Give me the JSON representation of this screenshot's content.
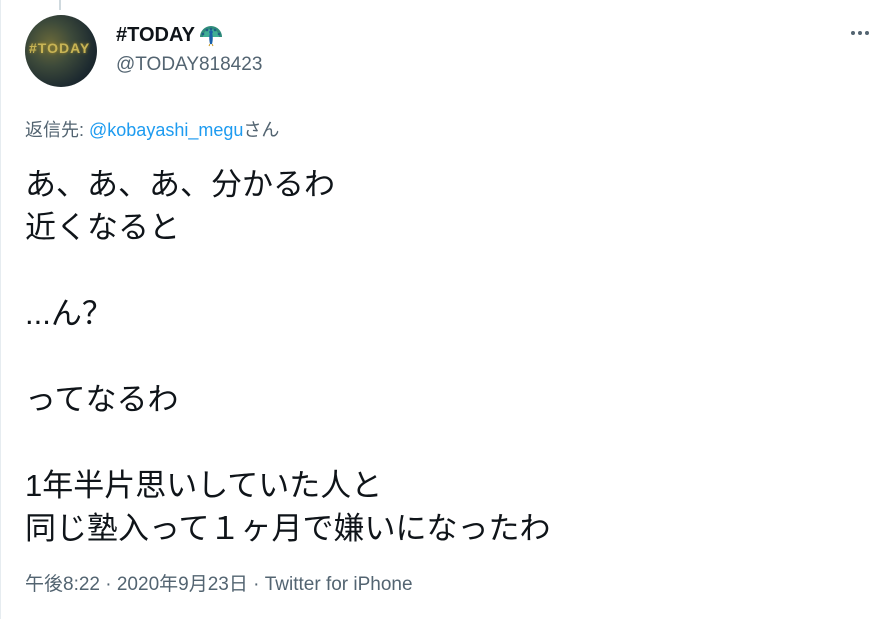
{
  "tweet": {
    "author": {
      "display_name": "#TODAY",
      "handle": "@TODAY818423",
      "avatar_text": "#TODAY",
      "name_icon": "peacock-emoji-icon"
    },
    "more_icon": "more-dots-icon",
    "reply_to": {
      "prefix": "返信先: ",
      "mention": "@kobayashi_megu",
      "suffix": "さん"
    },
    "text_lines": [
      "あ、あ、あ、分かるわ",
      "近くなると",
      "",
      "...ん？",
      "",
      "ってなるわ",
      "",
      "1年半片思いしていた人と",
      "同じ塾入って１ヶ月で嫌いになったわ"
    ],
    "timestamp": "午後8:22 · 2020年9月23日 · ",
    "source": "Twitter for iPhone"
  },
  "colors": {
    "text_primary": "#0f1419",
    "text_secondary": "#536471",
    "link": "#1d9bf0"
  }
}
